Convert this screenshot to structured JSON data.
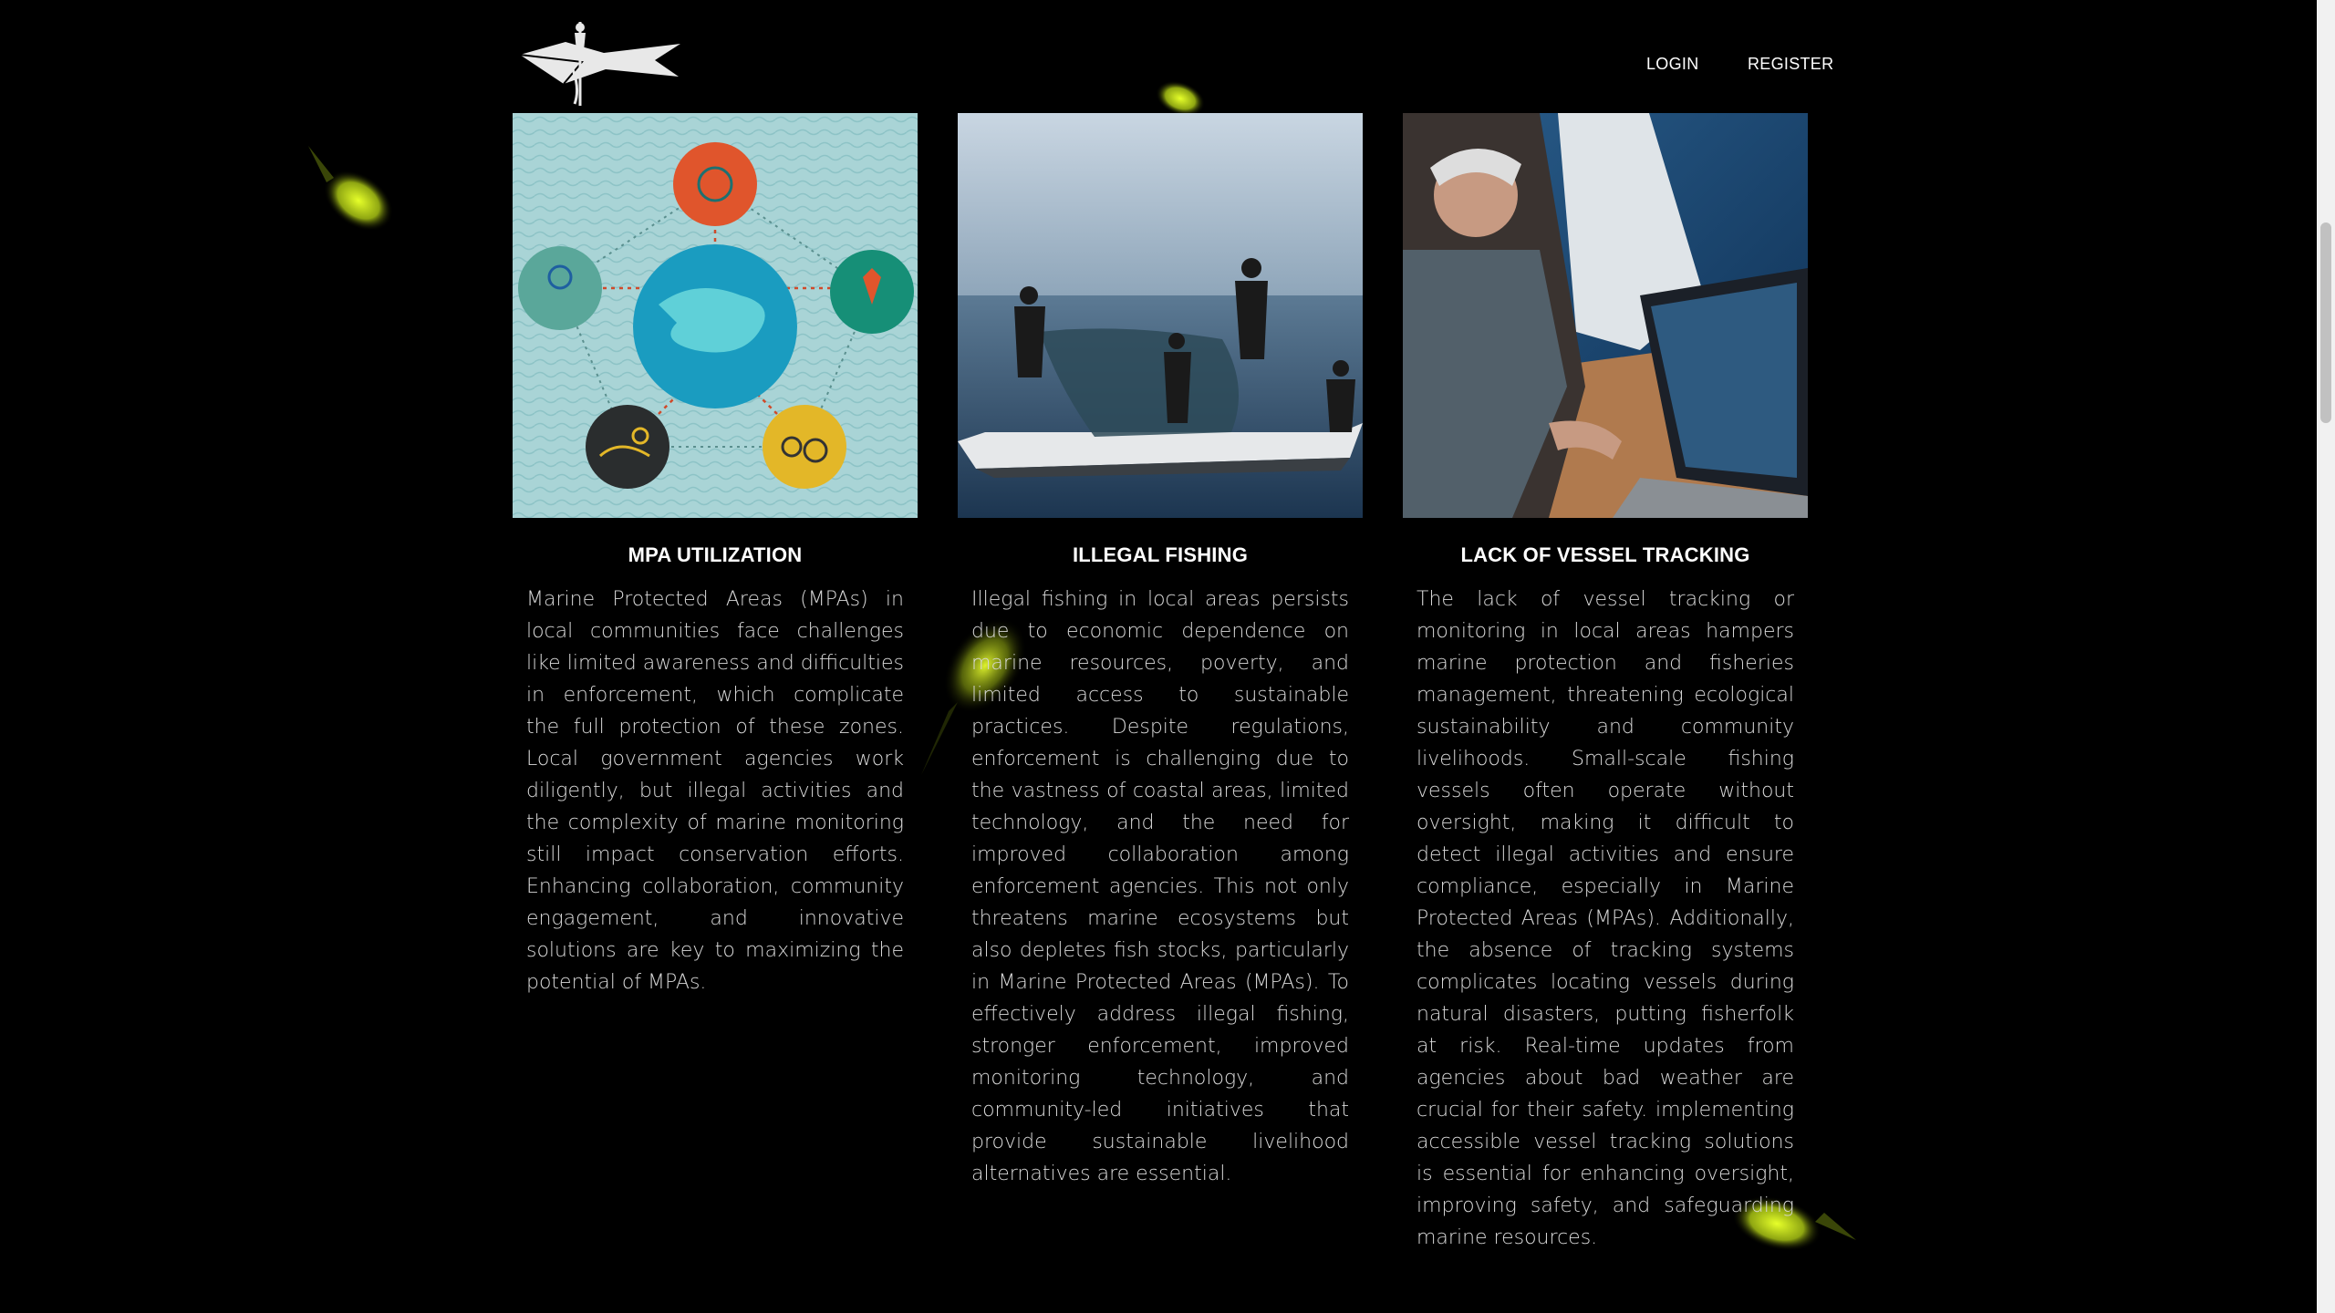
{
  "header": {
    "logo_icon": "fisherman-boat-logo-icon",
    "nav": [
      {
        "label": "LOGIN"
      },
      {
        "label": "REGISTER"
      }
    ]
  },
  "cards": [
    {
      "title": "MPA UTILIZATION",
      "image_icon": "mpa-infographic-icon",
      "body": "Marine Protected Areas (MPAs) in local communities face challenges like limited awareness and difficulties in enforcement, which complicate the full protection of these zones. Local government agencies work diligently, but illegal activities and the complexity of marine monitoring still impact conservation efforts. Enhancing collaboration, community engagement, and innovative solutions are key to maximizing the potential of MPAs."
    },
    {
      "title": "ILLEGAL FISHING",
      "image_icon": "fishermen-net-photo",
      "body": "Illegal fishing in local areas persists due to economic dependence on marine resources, poverty, and limited access to sustainable practices. Despite regulations, enforcement is challenging due to the vastness of coastal areas, limited technology, and the need for improved collaboration among enforcement agencies. This not only threatens marine ecosystems but also depletes fish stocks, particularly in Marine Protected Areas (MPAs). To effectively address illegal fishing, stronger enforcement, improved monitoring technology, and community-led initiatives that provide sustainable livelihood alternatives are essential."
    },
    {
      "title": "LACK OF VESSEL TRACKING",
      "image_icon": "vessel-laptop-photo",
      "body": "The lack of vessel tracking or monitoring in local areas hampers marine protection and fisheries management, threatening ecological sustainability and community livelihoods. Small-scale fishing vessels often operate without oversight, making it difficult to detect illegal activities and ensure compliance, especially in Marine Protected Areas (MPAs). Additionally, the absence of tracking systems complicates locating vessels during natural disasters, putting fisherfolk at risk. Real-time updates from agencies about bad weather are crucial for their safety. implementing accessible vessel tracking solutions is essential for enhancing oversight, improving safety, and safeguarding marine resources."
    }
  ],
  "colors": {
    "background": "#000000",
    "text": "#ffffff",
    "body_text": "#d8d8d8",
    "fish_glow": "#d7ef1a",
    "infographic_bg": "#a9d4d6"
  }
}
